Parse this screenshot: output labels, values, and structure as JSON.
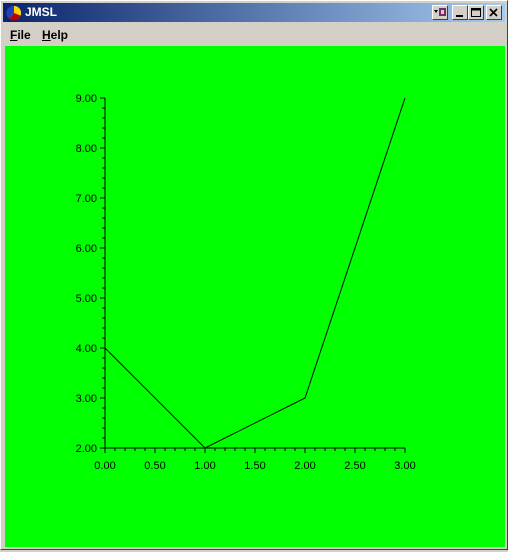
{
  "window": {
    "title": "JMSL",
    "icon": "jmsl-app-icon",
    "controls": [
      "menu-icon",
      "minimize-icon",
      "maximize-icon",
      "close-icon"
    ]
  },
  "menu": {
    "file": {
      "underline": "F",
      "rest": "ile"
    },
    "help": {
      "underline": "H",
      "rest": "elp"
    }
  },
  "colors": {
    "background": "#00ff00",
    "line": "#000000",
    "title_gradient_start": "#0a246a",
    "title_gradient_end": "#a6caf0"
  },
  "chart_data": {
    "type": "line",
    "x": [
      0.0,
      1.0,
      2.0,
      3.0
    ],
    "series": [
      {
        "values": [
          4.0,
          2.0,
          3.0,
          9.0
        ]
      }
    ],
    "xlim": [
      0.0,
      3.0
    ],
    "ylim": [
      2.0,
      9.0
    ],
    "xticks": [
      "0.00",
      "0.50",
      "1.00",
      "1.50",
      "2.00",
      "2.50",
      "3.00"
    ],
    "yticks": [
      "2.00",
      "3.00",
      "4.00",
      "5.00",
      "6.00",
      "7.00",
      "8.00",
      "9.00"
    ],
    "grid": false
  }
}
